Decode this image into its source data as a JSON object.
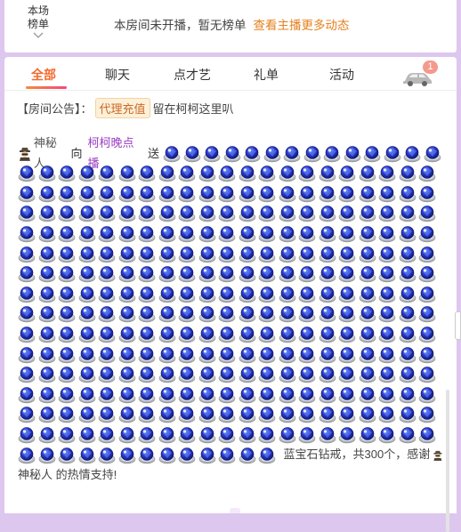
{
  "rank": {
    "toggle_line1": "本场",
    "toggle_line2": "榜单",
    "message": "本房间未开播，暂无榜单",
    "link": "查看主播更多动态"
  },
  "tabs": [
    {
      "label": "全部",
      "active": true
    },
    {
      "label": "聊天"
    },
    {
      "label": "点才艺"
    },
    {
      "label": "礼单"
    },
    {
      "label": "活动"
    }
  ],
  "car_badge": "1",
  "notice": {
    "prefix": "【房间公告】：",
    "tag": "代理充值",
    "text": "留在柯柯这里叭"
  },
  "gift_message": {
    "sender": "神秘人",
    "to_word": "向",
    "receiver": "柯柯晚点播",
    "send_word": "送",
    "gift_text": "蓝宝石钻戒，共300个，感谢",
    "thanks_line": "神秘人 的热情支持!"
  },
  "colors": {
    "accent": "#f26a2c",
    "background": "#ddc7ee",
    "name": "#9b3fc4",
    "gem": "#2a3fd0"
  },
  "icons": {
    "spy": "mysterious-person-icon",
    "gem": "blue-sapphire-ring-icon",
    "car": "car-icon"
  }
}
